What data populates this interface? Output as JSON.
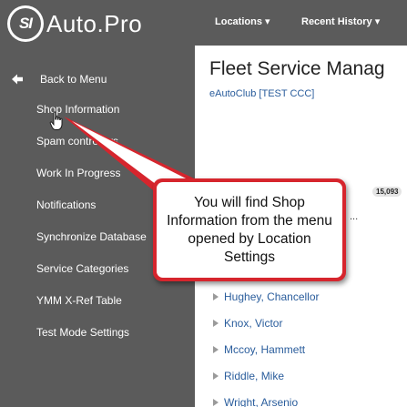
{
  "app": {
    "logo_badge": "SI",
    "logo_text": "Auto.Pro"
  },
  "topnav": {
    "locations": "Locations ▾",
    "recent_history": "Recent History ▾"
  },
  "sidebar": {
    "back_label": "Back to Menu",
    "items": [
      {
        "label": "Shop Information"
      },
      {
        "label": "Spam controllers"
      },
      {
        "label": "Work In Progress"
      },
      {
        "label": "Notifications"
      },
      {
        "label": "Synchronize Database"
      },
      {
        "label": "Service Categories"
      },
      {
        "label": "YMM X-Ref Table"
      },
      {
        "label": "Test Mode Settings"
      }
    ]
  },
  "main": {
    "title": "Fleet Service Manag",
    "subtitle": "eAutoClub [TEST CCC]",
    "count_badge": "15,093",
    "ellipsis": "...",
    "people": [
      {
        "name": "Hughey, Chancellor"
      },
      {
        "name": "Knox, Victor"
      },
      {
        "name": "Mccoy, Hammett"
      },
      {
        "name": "Riddle, Mike"
      },
      {
        "name": "Wright, Arsenio"
      }
    ]
  },
  "callout": {
    "text": "You will find Shop Information from the menu opened by Location Settings"
  },
  "colors": {
    "sidebar_bg": "#5b5b5b",
    "callout_border": "#d6252d",
    "link_blue": "#2a5d9c"
  }
}
